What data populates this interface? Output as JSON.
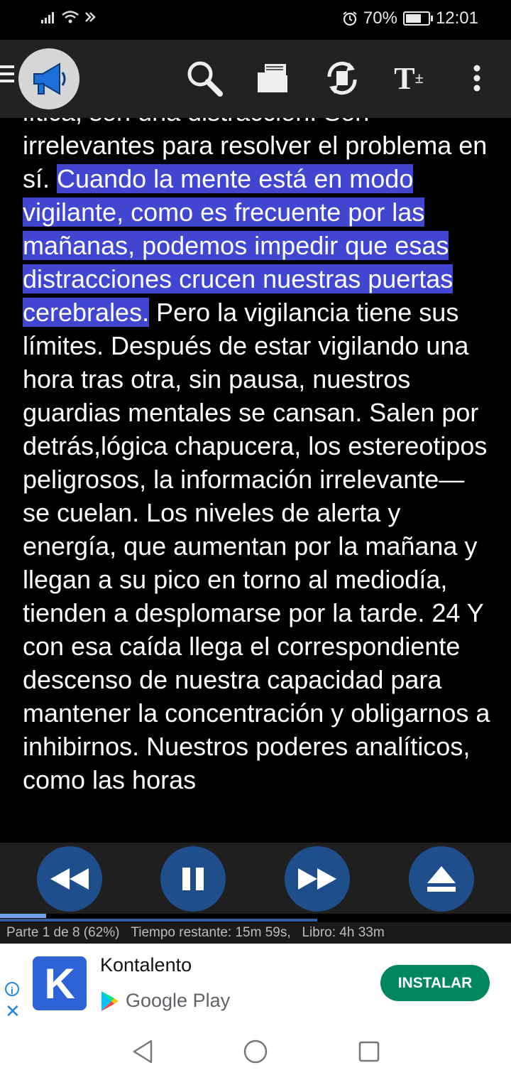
{
  "status_bar": {
    "battery_percent": "70%",
    "battery_level": 0.7,
    "time": "12:01"
  },
  "toolbar": {
    "icons": [
      "menu-icon",
      "app-logo-megaphone",
      "search-icon",
      "folder-icon",
      "sync-icon",
      "text-size-icon",
      "more-vert-icon"
    ],
    "text_size_label": "T",
    "text_size_plus": "±"
  },
  "reader": {
    "text_before": "lítica, son una distracción. Son irrelevantes para resolver el problema en sí. ",
    "text_highlighted": "Cuando la mente está en modo vigilante, como es frecuente por las mañanas, podemos impedir que esas distracciones crucen nuestras puertas cerebrales.",
    "text_after": " Pero la vigilancia tiene sus límites. Después de estar vigilando una hora tras otra, sin pausa, nuestros guardias mentales se cansan. Salen por detrás,lógica chapucera, los estereotipos peligrosos, la información irrelevante— se cuelan. Los niveles de alerta y energía, que aumentan por la mañana y llegan a su pico en torno al mediodía, tienden a desplomarse por la tarde. 24 Y con esa caída llega el correspondiente descenso de nuestra capacidad para mantener la concentración y obligarnos a inhibirnos. Nuestros poderes analíticos, como las horas"
  },
  "player": {
    "buttons": [
      "rewind-icon",
      "pause-icon",
      "fast-forward-icon",
      "eject-icon"
    ],
    "track_progress": 0.09,
    "part_label": "Parte 1 de 8 (62%)",
    "time_remaining_label": "Tiempo restante: 15m 59s,",
    "book_label": "Libro: 4h 33m"
  },
  "ad": {
    "app_name": "Kontalento",
    "logo_letter": "K",
    "store_name": "Google Play",
    "install_label": "INSTALAR",
    "info_label": "i",
    "close_label": "✕"
  },
  "colors": {
    "highlight": "#4146d0",
    "player_button": "#1f4e8c",
    "install_button": "#01875f"
  }
}
